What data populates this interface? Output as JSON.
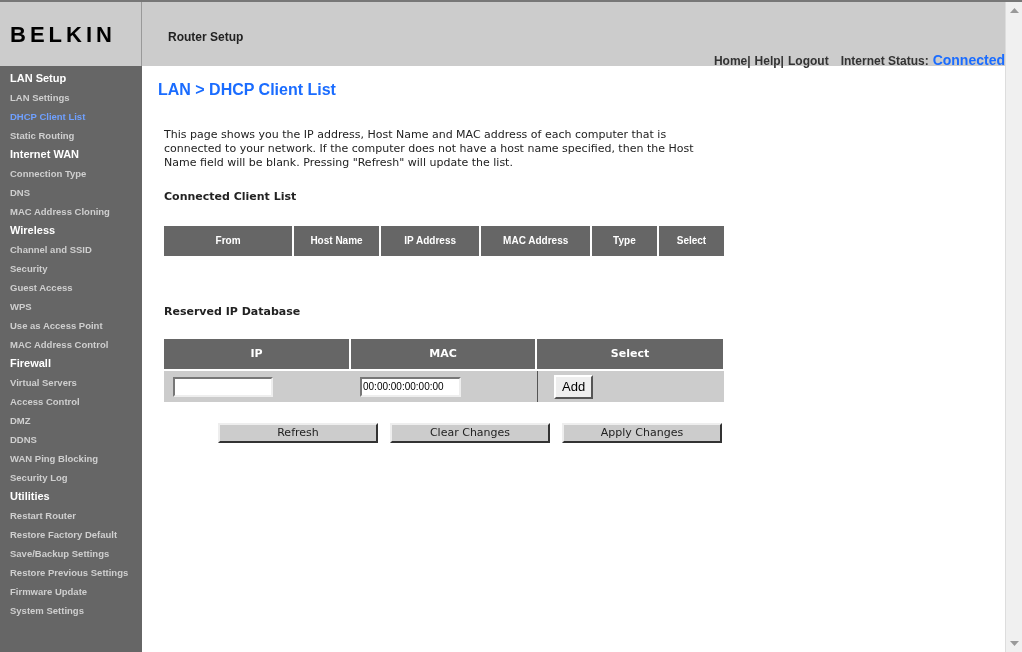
{
  "header": {
    "logo": "BELKIN",
    "title": "Router Setup",
    "links": [
      "Home|",
      "Help|",
      "Logout"
    ],
    "status_label": "Internet Status:",
    "status_value": "Connected"
  },
  "sidebar": [
    {
      "heading": "LAN Setup",
      "items": [
        {
          "label": "LAN Settings",
          "selected": false
        },
        {
          "label": "DHCP Client List",
          "selected": true
        },
        {
          "label": "Static Routing",
          "selected": false
        }
      ]
    },
    {
      "heading": "Internet WAN",
      "items": [
        {
          "label": "Connection Type",
          "selected": false
        },
        {
          "label": "DNS",
          "selected": false
        },
        {
          "label": "MAC Address Cloning",
          "selected": false
        }
      ]
    },
    {
      "heading": "Wireless",
      "items": [
        {
          "label": "Channel and SSID",
          "selected": false
        },
        {
          "label": "Security",
          "selected": false
        },
        {
          "label": "Guest Access",
          "selected": false
        },
        {
          "label": "WPS",
          "selected": false
        },
        {
          "label": "Use as Access Point",
          "selected": false
        },
        {
          "label": "MAC Address Control",
          "selected": false
        }
      ]
    },
    {
      "heading": "Firewall",
      "items": [
        {
          "label": "Virtual Servers",
          "selected": false
        },
        {
          "label": "Access Control",
          "selected": false
        },
        {
          "label": "DMZ",
          "selected": false
        },
        {
          "label": "DDNS",
          "selected": false
        },
        {
          "label": "WAN Ping Blocking",
          "selected": false
        },
        {
          "label": "Security Log",
          "selected": false
        }
      ]
    },
    {
      "heading": "Utilities",
      "items": [
        {
          "label": "Restart Router",
          "selected": false
        },
        {
          "label": "Restore Factory Default",
          "selected": false
        },
        {
          "label": "Save/Backup Settings",
          "selected": false
        },
        {
          "label": "Restore Previous Settings",
          "selected": false
        },
        {
          "label": "Firmware Update",
          "selected": false
        },
        {
          "label": "System Settings",
          "selected": false
        }
      ]
    }
  ],
  "page_title": "LAN > DHCP Client List",
  "description": "This page shows you the IP address, Host Name and MAC address of each computer that is connected to your network. If the computer does not have a host name specified, then the Host Name field will be blank. Pressing \"Refresh\" will update the list.",
  "client_list": {
    "title": "Connected Client List",
    "columns": [
      "From",
      "Host Name",
      "IP Address",
      "MAC Address",
      "Type",
      "Select"
    ]
  },
  "reserved": {
    "title": "Reserved IP Database",
    "columns": [
      "IP",
      "MAC",
      "Select"
    ],
    "mac_value": "00:00:00:00:00:00",
    "add_button": "Add"
  },
  "buttons": [
    "Refresh",
    "Clear Changes",
    "Apply Changes"
  ]
}
